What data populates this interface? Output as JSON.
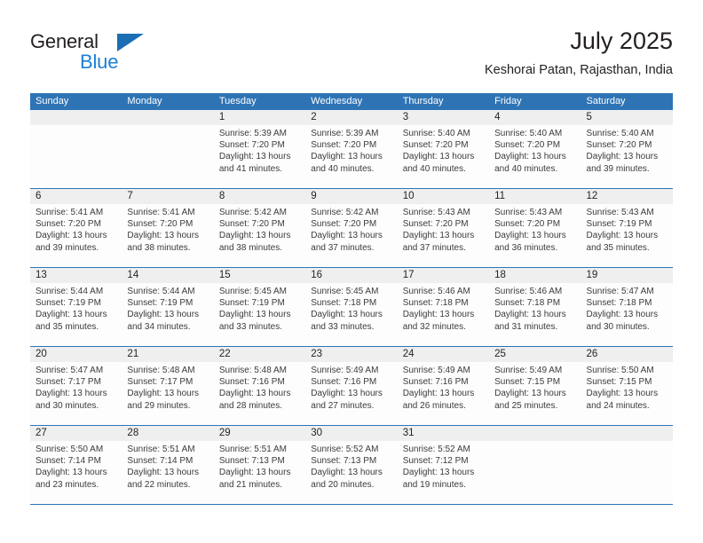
{
  "brand": {
    "word1": "General",
    "word2": "Blue",
    "triangle_color": "#1c6eb4",
    "word2_color": "#1c7fd6"
  },
  "header": {
    "title": "July 2025",
    "subtitle": "Keshorai Patan, Rajasthan, India",
    "header_bg": "#2e74b5",
    "header_text_color": "#ffffff",
    "daynum_bg": "#efefef"
  },
  "weekdays": [
    "Sunday",
    "Monday",
    "Tuesday",
    "Wednesday",
    "Thursday",
    "Friday",
    "Saturday"
  ],
  "labels": {
    "sunrise": "Sunrise:",
    "sunset": "Sunset:",
    "daylight": "Daylight:"
  },
  "weeks": [
    [
      {
        "day": "",
        "sunrise": "",
        "sunset": "",
        "daylight_a": "",
        "daylight_b": ""
      },
      {
        "day": "",
        "sunrise": "",
        "sunset": "",
        "daylight_a": "",
        "daylight_b": ""
      },
      {
        "day": "1",
        "sunrise": "Sunrise: 5:39 AM",
        "sunset": "Sunset: 7:20 PM",
        "daylight_a": "Daylight: 13 hours",
        "daylight_b": "and 41 minutes."
      },
      {
        "day": "2",
        "sunrise": "Sunrise: 5:39 AM",
        "sunset": "Sunset: 7:20 PM",
        "daylight_a": "Daylight: 13 hours",
        "daylight_b": "and 40 minutes."
      },
      {
        "day": "3",
        "sunrise": "Sunrise: 5:40 AM",
        "sunset": "Sunset: 7:20 PM",
        "daylight_a": "Daylight: 13 hours",
        "daylight_b": "and 40 minutes."
      },
      {
        "day": "4",
        "sunrise": "Sunrise: 5:40 AM",
        "sunset": "Sunset: 7:20 PM",
        "daylight_a": "Daylight: 13 hours",
        "daylight_b": "and 40 minutes."
      },
      {
        "day": "5",
        "sunrise": "Sunrise: 5:40 AM",
        "sunset": "Sunset: 7:20 PM",
        "daylight_a": "Daylight: 13 hours",
        "daylight_b": "and 39 minutes."
      }
    ],
    [
      {
        "day": "6",
        "sunrise": "Sunrise: 5:41 AM",
        "sunset": "Sunset: 7:20 PM",
        "daylight_a": "Daylight: 13 hours",
        "daylight_b": "and 39 minutes."
      },
      {
        "day": "7",
        "sunrise": "Sunrise: 5:41 AM",
        "sunset": "Sunset: 7:20 PM",
        "daylight_a": "Daylight: 13 hours",
        "daylight_b": "and 38 minutes."
      },
      {
        "day": "8",
        "sunrise": "Sunrise: 5:42 AM",
        "sunset": "Sunset: 7:20 PM",
        "daylight_a": "Daylight: 13 hours",
        "daylight_b": "and 38 minutes."
      },
      {
        "day": "9",
        "sunrise": "Sunrise: 5:42 AM",
        "sunset": "Sunset: 7:20 PM",
        "daylight_a": "Daylight: 13 hours",
        "daylight_b": "and 37 minutes."
      },
      {
        "day": "10",
        "sunrise": "Sunrise: 5:43 AM",
        "sunset": "Sunset: 7:20 PM",
        "daylight_a": "Daylight: 13 hours",
        "daylight_b": "and 37 minutes."
      },
      {
        "day": "11",
        "sunrise": "Sunrise: 5:43 AM",
        "sunset": "Sunset: 7:20 PM",
        "daylight_a": "Daylight: 13 hours",
        "daylight_b": "and 36 minutes."
      },
      {
        "day": "12",
        "sunrise": "Sunrise: 5:43 AM",
        "sunset": "Sunset: 7:19 PM",
        "daylight_a": "Daylight: 13 hours",
        "daylight_b": "and 35 minutes."
      }
    ],
    [
      {
        "day": "13",
        "sunrise": "Sunrise: 5:44 AM",
        "sunset": "Sunset: 7:19 PM",
        "daylight_a": "Daylight: 13 hours",
        "daylight_b": "and 35 minutes."
      },
      {
        "day": "14",
        "sunrise": "Sunrise: 5:44 AM",
        "sunset": "Sunset: 7:19 PM",
        "daylight_a": "Daylight: 13 hours",
        "daylight_b": "and 34 minutes."
      },
      {
        "day": "15",
        "sunrise": "Sunrise: 5:45 AM",
        "sunset": "Sunset: 7:19 PM",
        "daylight_a": "Daylight: 13 hours",
        "daylight_b": "and 33 minutes."
      },
      {
        "day": "16",
        "sunrise": "Sunrise: 5:45 AM",
        "sunset": "Sunset: 7:18 PM",
        "daylight_a": "Daylight: 13 hours",
        "daylight_b": "and 33 minutes."
      },
      {
        "day": "17",
        "sunrise": "Sunrise: 5:46 AM",
        "sunset": "Sunset: 7:18 PM",
        "daylight_a": "Daylight: 13 hours",
        "daylight_b": "and 32 minutes."
      },
      {
        "day": "18",
        "sunrise": "Sunrise: 5:46 AM",
        "sunset": "Sunset: 7:18 PM",
        "daylight_a": "Daylight: 13 hours",
        "daylight_b": "and 31 minutes."
      },
      {
        "day": "19",
        "sunrise": "Sunrise: 5:47 AM",
        "sunset": "Sunset: 7:18 PM",
        "daylight_a": "Daylight: 13 hours",
        "daylight_b": "and 30 minutes."
      }
    ],
    [
      {
        "day": "20",
        "sunrise": "Sunrise: 5:47 AM",
        "sunset": "Sunset: 7:17 PM",
        "daylight_a": "Daylight: 13 hours",
        "daylight_b": "and 30 minutes."
      },
      {
        "day": "21",
        "sunrise": "Sunrise: 5:48 AM",
        "sunset": "Sunset: 7:17 PM",
        "daylight_a": "Daylight: 13 hours",
        "daylight_b": "and 29 minutes."
      },
      {
        "day": "22",
        "sunrise": "Sunrise: 5:48 AM",
        "sunset": "Sunset: 7:16 PM",
        "daylight_a": "Daylight: 13 hours",
        "daylight_b": "and 28 minutes."
      },
      {
        "day": "23",
        "sunrise": "Sunrise: 5:49 AM",
        "sunset": "Sunset: 7:16 PM",
        "daylight_a": "Daylight: 13 hours",
        "daylight_b": "and 27 minutes."
      },
      {
        "day": "24",
        "sunrise": "Sunrise: 5:49 AM",
        "sunset": "Sunset: 7:16 PM",
        "daylight_a": "Daylight: 13 hours",
        "daylight_b": "and 26 minutes."
      },
      {
        "day": "25",
        "sunrise": "Sunrise: 5:49 AM",
        "sunset": "Sunset: 7:15 PM",
        "daylight_a": "Daylight: 13 hours",
        "daylight_b": "and 25 minutes."
      },
      {
        "day": "26",
        "sunrise": "Sunrise: 5:50 AM",
        "sunset": "Sunset: 7:15 PM",
        "daylight_a": "Daylight: 13 hours",
        "daylight_b": "and 24 minutes."
      }
    ],
    [
      {
        "day": "27",
        "sunrise": "Sunrise: 5:50 AM",
        "sunset": "Sunset: 7:14 PM",
        "daylight_a": "Daylight: 13 hours",
        "daylight_b": "and 23 minutes."
      },
      {
        "day": "28",
        "sunrise": "Sunrise: 5:51 AM",
        "sunset": "Sunset: 7:14 PM",
        "daylight_a": "Daylight: 13 hours",
        "daylight_b": "and 22 minutes."
      },
      {
        "day": "29",
        "sunrise": "Sunrise: 5:51 AM",
        "sunset": "Sunset: 7:13 PM",
        "daylight_a": "Daylight: 13 hours",
        "daylight_b": "and 21 minutes."
      },
      {
        "day": "30",
        "sunrise": "Sunrise: 5:52 AM",
        "sunset": "Sunset: 7:13 PM",
        "daylight_a": "Daylight: 13 hours",
        "daylight_b": "and 20 minutes."
      },
      {
        "day": "31",
        "sunrise": "Sunrise: 5:52 AM",
        "sunset": "Sunset: 7:12 PM",
        "daylight_a": "Daylight: 13 hours",
        "daylight_b": "and 19 minutes."
      },
      {
        "day": "",
        "sunrise": "",
        "sunset": "",
        "daylight_a": "",
        "daylight_b": ""
      },
      {
        "day": "",
        "sunrise": "",
        "sunset": "",
        "daylight_a": "",
        "daylight_b": ""
      }
    ]
  ]
}
